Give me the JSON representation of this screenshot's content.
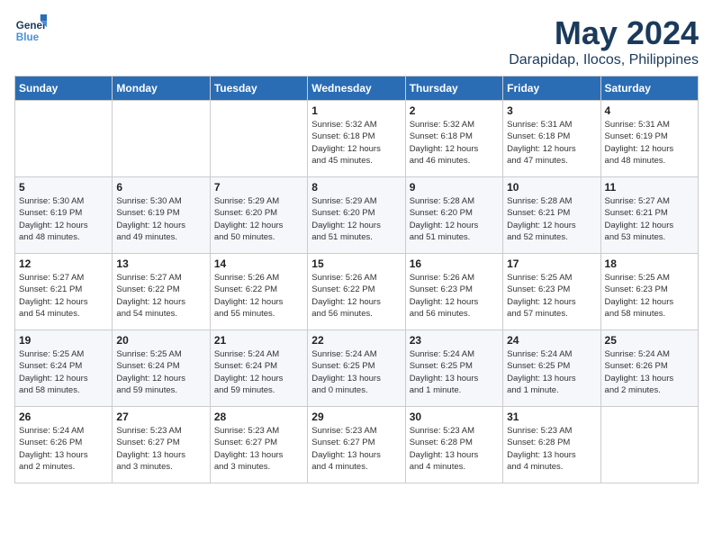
{
  "header": {
    "logo_general": "General",
    "logo_blue": "Blue",
    "month": "May 2024",
    "location": "Darapidap, Ilocos, Philippines"
  },
  "weekdays": [
    "Sunday",
    "Monday",
    "Tuesday",
    "Wednesday",
    "Thursday",
    "Friday",
    "Saturday"
  ],
  "weeks": [
    [
      {
        "day": "",
        "info": ""
      },
      {
        "day": "",
        "info": ""
      },
      {
        "day": "",
        "info": ""
      },
      {
        "day": "1",
        "info": "Sunrise: 5:32 AM\nSunset: 6:18 PM\nDaylight: 12 hours\nand 45 minutes."
      },
      {
        "day": "2",
        "info": "Sunrise: 5:32 AM\nSunset: 6:18 PM\nDaylight: 12 hours\nand 46 minutes."
      },
      {
        "day": "3",
        "info": "Sunrise: 5:31 AM\nSunset: 6:18 PM\nDaylight: 12 hours\nand 47 minutes."
      },
      {
        "day": "4",
        "info": "Sunrise: 5:31 AM\nSunset: 6:19 PM\nDaylight: 12 hours\nand 48 minutes."
      }
    ],
    [
      {
        "day": "5",
        "info": "Sunrise: 5:30 AM\nSunset: 6:19 PM\nDaylight: 12 hours\nand 48 minutes."
      },
      {
        "day": "6",
        "info": "Sunrise: 5:30 AM\nSunset: 6:19 PM\nDaylight: 12 hours\nand 49 minutes."
      },
      {
        "day": "7",
        "info": "Sunrise: 5:29 AM\nSunset: 6:20 PM\nDaylight: 12 hours\nand 50 minutes."
      },
      {
        "day": "8",
        "info": "Sunrise: 5:29 AM\nSunset: 6:20 PM\nDaylight: 12 hours\nand 51 minutes."
      },
      {
        "day": "9",
        "info": "Sunrise: 5:28 AM\nSunset: 6:20 PM\nDaylight: 12 hours\nand 51 minutes."
      },
      {
        "day": "10",
        "info": "Sunrise: 5:28 AM\nSunset: 6:21 PM\nDaylight: 12 hours\nand 52 minutes."
      },
      {
        "day": "11",
        "info": "Sunrise: 5:27 AM\nSunset: 6:21 PM\nDaylight: 12 hours\nand 53 minutes."
      }
    ],
    [
      {
        "day": "12",
        "info": "Sunrise: 5:27 AM\nSunset: 6:21 PM\nDaylight: 12 hours\nand 54 minutes."
      },
      {
        "day": "13",
        "info": "Sunrise: 5:27 AM\nSunset: 6:22 PM\nDaylight: 12 hours\nand 54 minutes."
      },
      {
        "day": "14",
        "info": "Sunrise: 5:26 AM\nSunset: 6:22 PM\nDaylight: 12 hours\nand 55 minutes."
      },
      {
        "day": "15",
        "info": "Sunrise: 5:26 AM\nSunset: 6:22 PM\nDaylight: 12 hours\nand 56 minutes."
      },
      {
        "day": "16",
        "info": "Sunrise: 5:26 AM\nSunset: 6:23 PM\nDaylight: 12 hours\nand 56 minutes."
      },
      {
        "day": "17",
        "info": "Sunrise: 5:25 AM\nSunset: 6:23 PM\nDaylight: 12 hours\nand 57 minutes."
      },
      {
        "day": "18",
        "info": "Sunrise: 5:25 AM\nSunset: 6:23 PM\nDaylight: 12 hours\nand 58 minutes."
      }
    ],
    [
      {
        "day": "19",
        "info": "Sunrise: 5:25 AM\nSunset: 6:24 PM\nDaylight: 12 hours\nand 58 minutes."
      },
      {
        "day": "20",
        "info": "Sunrise: 5:25 AM\nSunset: 6:24 PM\nDaylight: 12 hours\nand 59 minutes."
      },
      {
        "day": "21",
        "info": "Sunrise: 5:24 AM\nSunset: 6:24 PM\nDaylight: 12 hours\nand 59 minutes."
      },
      {
        "day": "22",
        "info": "Sunrise: 5:24 AM\nSunset: 6:25 PM\nDaylight: 13 hours\nand 0 minutes."
      },
      {
        "day": "23",
        "info": "Sunrise: 5:24 AM\nSunset: 6:25 PM\nDaylight: 13 hours\nand 1 minute."
      },
      {
        "day": "24",
        "info": "Sunrise: 5:24 AM\nSunset: 6:25 PM\nDaylight: 13 hours\nand 1 minute."
      },
      {
        "day": "25",
        "info": "Sunrise: 5:24 AM\nSunset: 6:26 PM\nDaylight: 13 hours\nand 2 minutes."
      }
    ],
    [
      {
        "day": "26",
        "info": "Sunrise: 5:24 AM\nSunset: 6:26 PM\nDaylight: 13 hours\nand 2 minutes."
      },
      {
        "day": "27",
        "info": "Sunrise: 5:23 AM\nSunset: 6:27 PM\nDaylight: 13 hours\nand 3 minutes."
      },
      {
        "day": "28",
        "info": "Sunrise: 5:23 AM\nSunset: 6:27 PM\nDaylight: 13 hours\nand 3 minutes."
      },
      {
        "day": "29",
        "info": "Sunrise: 5:23 AM\nSunset: 6:27 PM\nDaylight: 13 hours\nand 4 minutes."
      },
      {
        "day": "30",
        "info": "Sunrise: 5:23 AM\nSunset: 6:28 PM\nDaylight: 13 hours\nand 4 minutes."
      },
      {
        "day": "31",
        "info": "Sunrise: 5:23 AM\nSunset: 6:28 PM\nDaylight: 13 hours\nand 4 minutes."
      },
      {
        "day": "",
        "info": ""
      }
    ]
  ]
}
